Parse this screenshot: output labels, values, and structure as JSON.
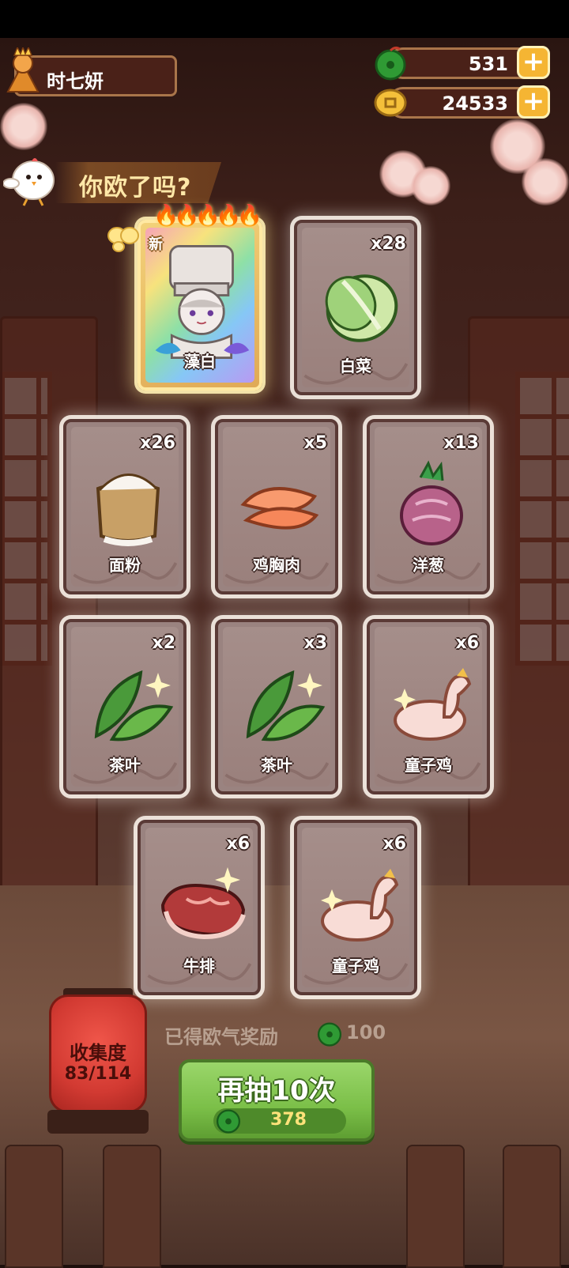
{
  "player": {
    "name": "时七妍"
  },
  "resources": {
    "jade": {
      "value": "531",
      "icon": "green-jade-icon"
    },
    "coins": {
      "value": "24533",
      "icon": "gold-coin-icon"
    }
  },
  "banner": {
    "text": "你欧了吗?"
  },
  "special_card": {
    "flames": "🔥🔥🔥🔥🔥",
    "tag": "新",
    "name": "藻白",
    "rarity_flames": 5
  },
  "cards": [
    {
      "name": "白菜",
      "count": "x28",
      "icon": "napa-cabbage-icon"
    },
    {
      "name": "面粉",
      "count": "x26",
      "icon": "flour-sack-icon"
    },
    {
      "name": "鸡胸肉",
      "count": "x5",
      "icon": "chicken-breast-icon"
    },
    {
      "name": "洋葱",
      "count": "x13",
      "icon": "onion-icon"
    },
    {
      "name": "茶叶",
      "count": "x2",
      "icon": "tea-leaf-icon"
    },
    {
      "name": "茶叶",
      "count": "x3",
      "icon": "tea-leaf-icon"
    },
    {
      "name": "童子鸡",
      "count": "x6",
      "icon": "young-chicken-icon"
    },
    {
      "name": "牛排",
      "count": "x6",
      "icon": "steak-icon"
    },
    {
      "name": "童子鸡",
      "count": "x6",
      "icon": "young-chicken-icon"
    }
  ],
  "collection": {
    "title": "收集度",
    "progress": "83/114"
  },
  "reward": {
    "label": "已得欧气奖励",
    "value": "100"
  },
  "draw_button": {
    "label": "再抽10次",
    "cost": "378"
  },
  "colors": {
    "accent_green": "#7bbf48",
    "gold": "#f5b533",
    "plate": "#4a2118"
  }
}
